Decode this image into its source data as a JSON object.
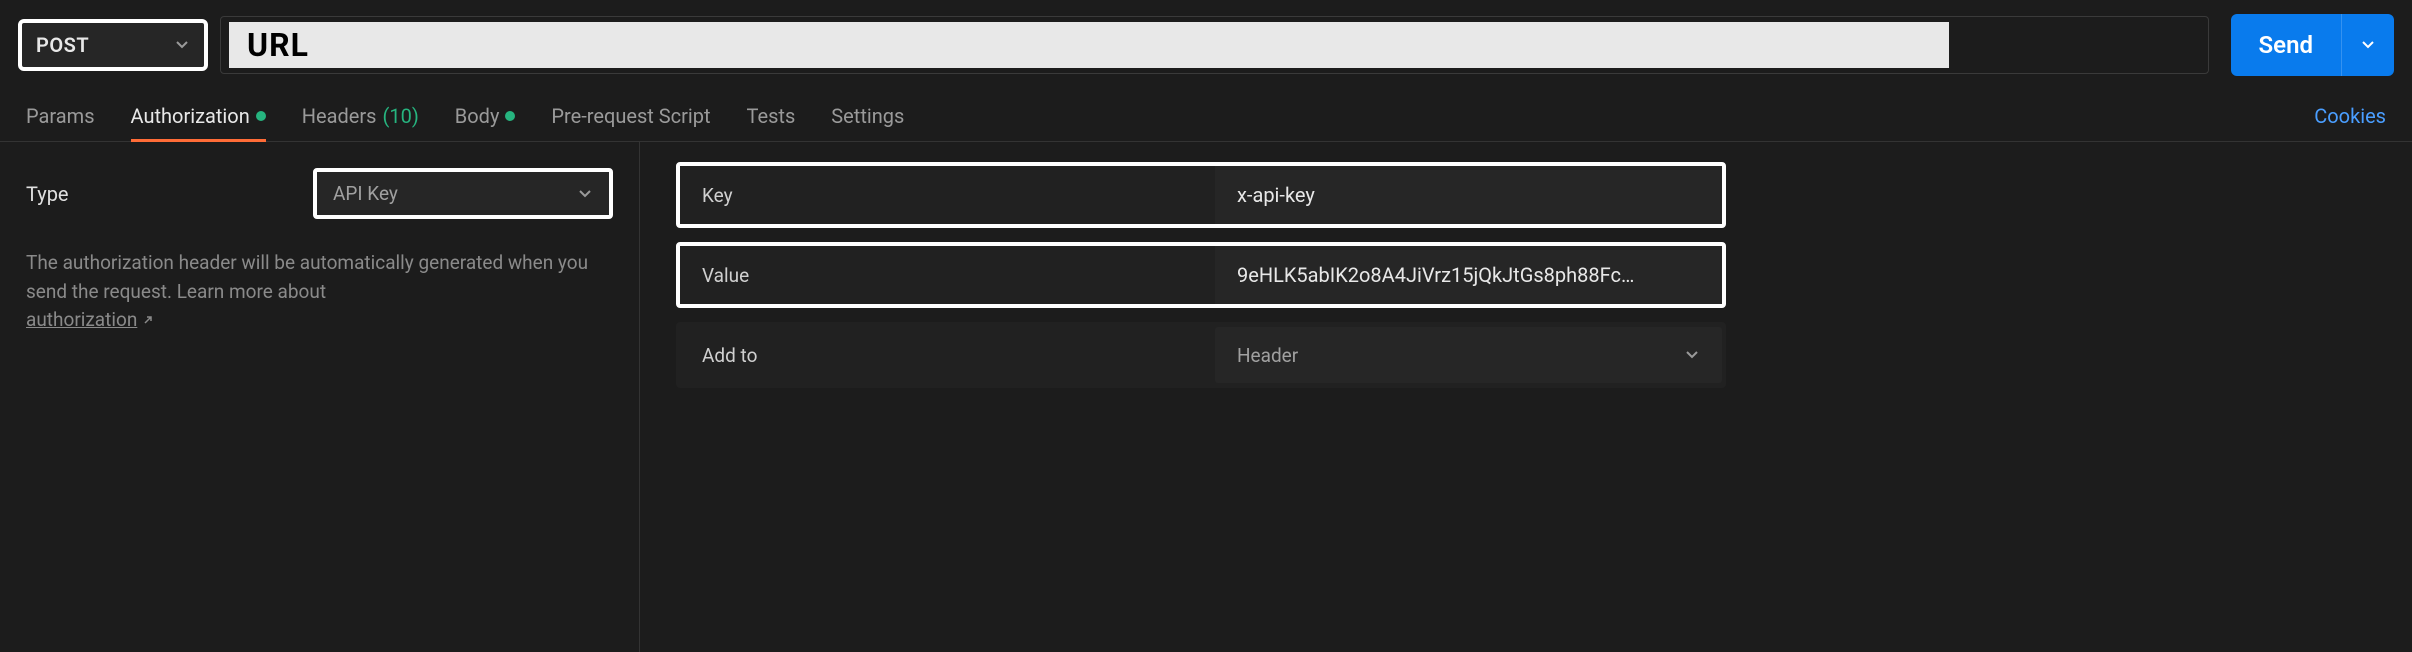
{
  "request": {
    "method": "POST",
    "url": "URL",
    "sendLabel": "Send"
  },
  "tabs": {
    "params": "Params",
    "authorization": "Authorization",
    "headers": "Headers",
    "headersCount": "(10)",
    "body": "Body",
    "preRequest": "Pre-request Script",
    "tests": "Tests",
    "settings": "Settings",
    "cookies": "Cookies"
  },
  "auth": {
    "typeLabel": "Type",
    "typeValue": "API Key",
    "helpText1": "The authorization header will be automatically generated when you send the request. Learn more about ",
    "helpLinkText": "authorization",
    "keyLabel": "Key",
    "keyValue": "x-api-key",
    "valueLabel": "Value",
    "valueValue": "9eHLK5abIK2o8A4JiVrz15jQkJtGs8ph88Fc…",
    "addToLabel": "Add to",
    "addToValue": "Header"
  }
}
